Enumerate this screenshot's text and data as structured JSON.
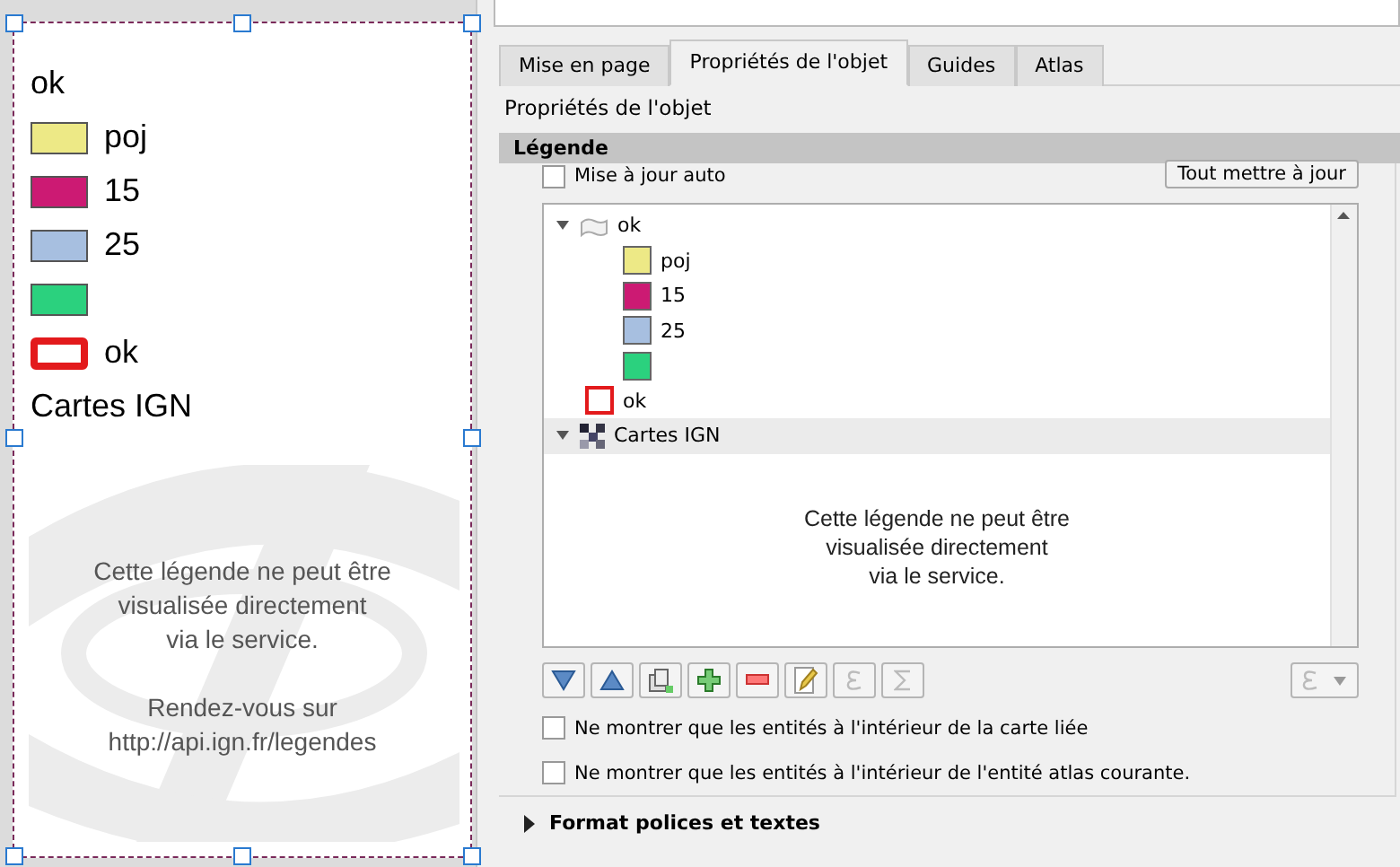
{
  "page_legend": {
    "items": [
      {
        "kind": "group",
        "label": "ok"
      },
      {
        "kind": "swatch",
        "label": "poj",
        "color": "#ede986"
      },
      {
        "kind": "swatch",
        "label": "15",
        "color": "#cc1a73"
      },
      {
        "kind": "swatch",
        "label": "25",
        "color": "#a7bfe0"
      },
      {
        "kind": "swatch",
        "color": "#2bd17e"
      },
      {
        "kind": "outline",
        "label": "ok",
        "color": "#e31a1c"
      },
      {
        "kind": "group",
        "label": "Cartes IGN"
      }
    ],
    "notice": [
      [
        "Cette légende ne peut être",
        "visualisée directement",
        "via le service."
      ],
      [
        "Rendez-vous sur",
        "http://api.ign.fr/legendes"
      ]
    ]
  },
  "tabs": [
    {
      "label": "Mise en page",
      "selected": false
    },
    {
      "label": "Propriétés de l'objet",
      "selected": true
    },
    {
      "label": "Guides",
      "selected": false
    },
    {
      "label": "Atlas",
      "selected": false
    }
  ],
  "panel_title": "Propriétés de l'objet",
  "section": {
    "title": "Légende",
    "expanded": true
  },
  "auto_update": {
    "label": "Mise à jour auto",
    "checked": false
  },
  "update_all_button": "Tout mettre à jour",
  "tree": [
    {
      "kind": "group",
      "label": "ok",
      "expanded": true,
      "selected": false,
      "children": [
        {
          "kind": "swatch",
          "label": "poj",
          "color": "#ede986",
          "selected": false
        },
        {
          "kind": "swatch",
          "label": "15",
          "color": "#cc1a73",
          "selected": false
        },
        {
          "kind": "swatch",
          "label": "25",
          "color": "#a7bfe0",
          "selected": false
        },
        {
          "kind": "swatch",
          "color": "#2bd17e",
          "selected": false
        }
      ]
    },
    {
      "kind": "outline",
      "label": "ok",
      "color": "#e31a1c",
      "selected": false
    },
    {
      "kind": "raster",
      "label": "Cartes IGN",
      "expanded": true,
      "selected": true
    }
  ],
  "tree_notice": [
    "Cette légende ne peut être",
    "visualisée directement",
    "via le service."
  ],
  "toolbar": [
    {
      "kind": "down",
      "disabled": false
    },
    {
      "kind": "up",
      "disabled": false
    },
    {
      "kind": "add-group",
      "disabled": false
    },
    {
      "kind": "add",
      "disabled": false
    },
    {
      "kind": "remove",
      "disabled": false
    },
    {
      "kind": "edit",
      "disabled": false
    },
    {
      "kind": "epsilon",
      "disabled": true
    },
    {
      "kind": "sigma",
      "disabled": true
    }
  ],
  "checkboxes": [
    {
      "label": "Ne montrer que les entités à l'intérieur de la carte liée",
      "checked": false
    },
    {
      "label": "Ne montrer que les entités à l'intérieur de l'entité atlas courante.",
      "checked": false
    }
  ],
  "next_section": {
    "title": "Format polices et textes",
    "expanded": false
  }
}
